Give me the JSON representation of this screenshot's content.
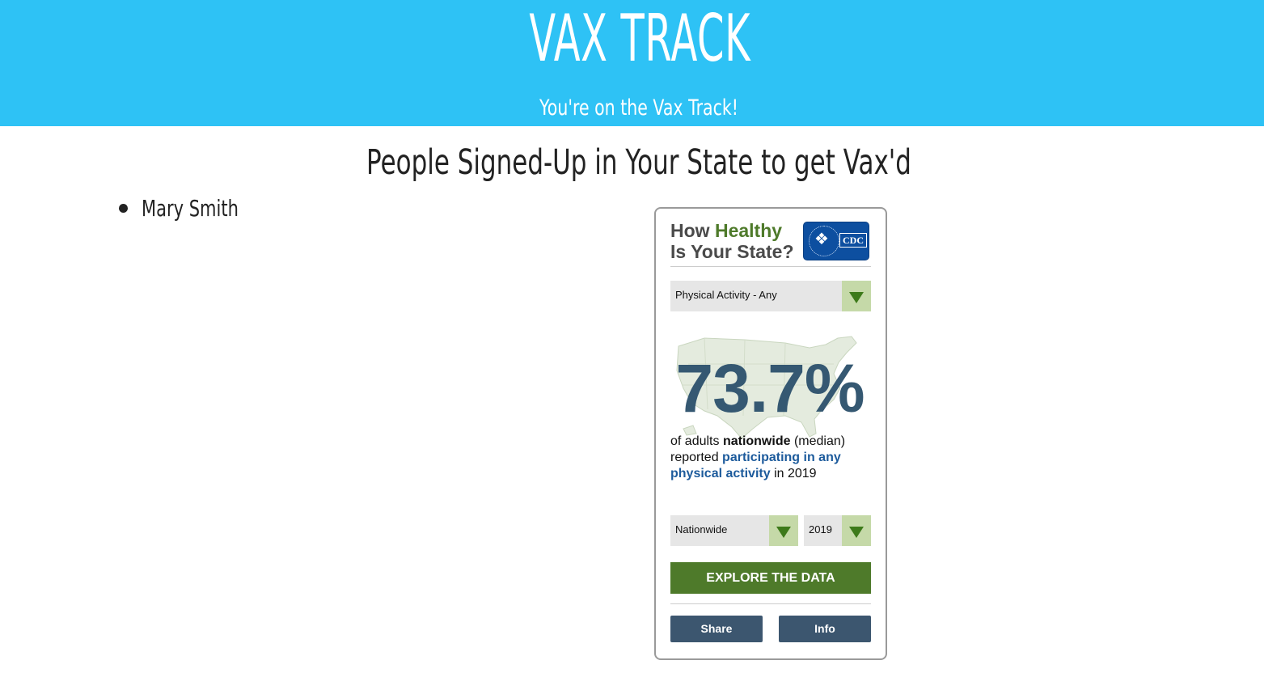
{
  "header": {
    "title": "VAX TRACK",
    "tagline": "You're on the Vax Track!"
  },
  "main": {
    "heading": "People Signed-Up in Your State to get Vax'd",
    "people": [
      "Mary Smith"
    ]
  },
  "widget": {
    "title_line1_a": "How ",
    "title_line1_b": "Healthy",
    "title_line2": "Is Your State?",
    "logo_text": "CDC",
    "topic_select": "Physical Activity - Any",
    "stat_value": "73.7%",
    "desc_part1": "of adults ",
    "desc_bold": "nationwide",
    "desc_part2": " (median) reported ",
    "desc_link": "participating in any physical activity",
    "desc_part3": " in 2019",
    "location_select": "Nationwide",
    "year_select": "2019",
    "explore_button": "EXPLORE THE DATA",
    "share_button": "Share",
    "info_button": "Info",
    "colors": {
      "brand_green": "#4e7a2a",
      "stat_blue": "#355872",
      "link_blue": "#1d5b9c",
      "button_slate": "#3c566f"
    }
  }
}
